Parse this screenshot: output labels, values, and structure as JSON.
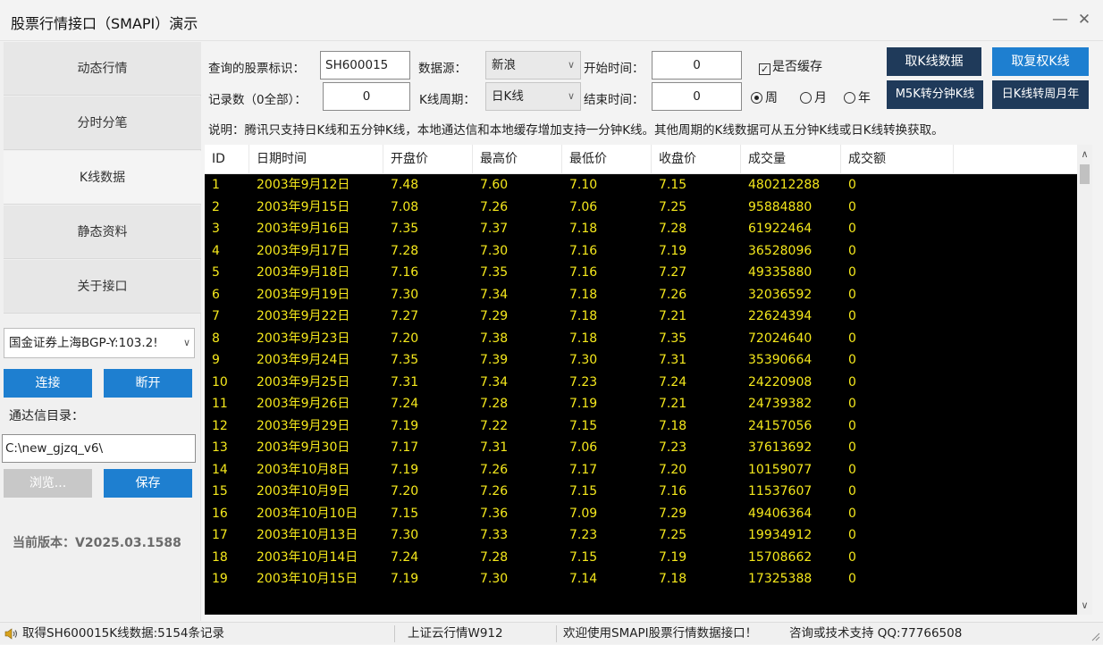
{
  "window": {
    "title": "股票行情接口（SMAPI）演示",
    "minimize_glyph": "—",
    "close_glyph": "✕"
  },
  "sidebar": {
    "nav": [
      {
        "label": "动态行情"
      },
      {
        "label": "分时分笔"
      },
      {
        "label": "K线数据"
      },
      {
        "label": "静态资料"
      },
      {
        "label": "关于接口"
      }
    ],
    "server_selected": "国金证券上海BGP-Y:103.2!",
    "connect_label": "连接",
    "disconnect_label": "断开",
    "tdx_dir_label": "通达信目录：",
    "tdx_dir_value": "C:\\new_gjzq_v6\\",
    "browse_label": "浏览...",
    "save_label": "保存",
    "version_text": "当前版本：V2025.03.1588"
  },
  "form": {
    "stock_id_label": "查询的股票标识：",
    "stock_id_value": "SH600015",
    "source_label": "数据源：",
    "source_value": "新浪",
    "start_time_label": "开始时间：",
    "start_time_value": "0",
    "cache_label": "是否缓存",
    "cache_checked": true,
    "record_count_label": "记录数（0全部）：",
    "record_count_value": "0",
    "kline_period_label": "K线周期：",
    "kline_period_value": "日K线",
    "end_time_label": "结束时间：",
    "end_time_value": "0",
    "radio_week": "周",
    "radio_month": "月",
    "radio_year": "年",
    "radio_selected": "周",
    "btn_get_kline": "取K线数据",
    "btn_get_adjusted": "取复权K线",
    "btn_m5_to_min": "M5K转分钟K线",
    "btn_day_to_wmy": "日K线转周月年",
    "notice": "说明：腾讯只支持日K线和五分钟K线，本地通达信和本地缓存增加支持一分钟K线。其他周期的K线数据可从五分钟K线或日K线转换获取。"
  },
  "table": {
    "columns": [
      "ID",
      "日期时间",
      "开盘价",
      "最高价",
      "最低价",
      "收盘价",
      "成交量",
      "成交额"
    ],
    "rows": [
      [
        "1",
        "2003年9月12日",
        "7.48",
        "7.60",
        "7.10",
        "7.15",
        "480212288",
        "0"
      ],
      [
        "2",
        "2003年9月15日",
        "7.08",
        "7.26",
        "7.06",
        "7.25",
        "95884880",
        "0"
      ],
      [
        "3",
        "2003年9月16日",
        "7.35",
        "7.37",
        "7.18",
        "7.28",
        "61922464",
        "0"
      ],
      [
        "4",
        "2003年9月17日",
        "7.28",
        "7.30",
        "7.16",
        "7.19",
        "36528096",
        "0"
      ],
      [
        "5",
        "2003年9月18日",
        "7.16",
        "7.35",
        "7.16",
        "7.27",
        "49335880",
        "0"
      ],
      [
        "6",
        "2003年9月19日",
        "7.30",
        "7.34",
        "7.18",
        "7.26",
        "32036592",
        "0"
      ],
      [
        "7",
        "2003年9月22日",
        "7.27",
        "7.29",
        "7.18",
        "7.21",
        "22624394",
        "0"
      ],
      [
        "8",
        "2003年9月23日",
        "7.20",
        "7.38",
        "7.18",
        "7.35",
        "72024640",
        "0"
      ],
      [
        "9",
        "2003年9月24日",
        "7.35",
        "7.39",
        "7.30",
        "7.31",
        "35390664",
        "0"
      ],
      [
        "10",
        "2003年9月25日",
        "7.31",
        "7.34",
        "7.23",
        "7.24",
        "24220908",
        "0"
      ],
      [
        "11",
        "2003年9月26日",
        "7.24",
        "7.28",
        "7.19",
        "7.21",
        "24739382",
        "0"
      ],
      [
        "12",
        "2003年9月29日",
        "7.19",
        "7.22",
        "7.15",
        "7.18",
        "24157056",
        "0"
      ],
      [
        "13",
        "2003年9月30日",
        "7.17",
        "7.31",
        "7.06",
        "7.23",
        "37613692",
        "0"
      ],
      [
        "14",
        "2003年10月8日",
        "7.19",
        "7.26",
        "7.17",
        "7.20",
        "10159077",
        "0"
      ],
      [
        "15",
        "2003年10月9日",
        "7.20",
        "7.26",
        "7.15",
        "7.16",
        "11537607",
        "0"
      ],
      [
        "16",
        "2003年10月10日",
        "7.15",
        "7.36",
        "7.09",
        "7.29",
        "49406364",
        "0"
      ],
      [
        "17",
        "2003年10月13日",
        "7.30",
        "7.33",
        "7.23",
        "7.25",
        "19934912",
        "0"
      ],
      [
        "18",
        "2003年10月14日",
        "7.24",
        "7.28",
        "7.15",
        "7.19",
        "15708662",
        "0"
      ],
      [
        "19",
        "2003年10月15日",
        "7.19",
        "7.30",
        "7.14",
        "7.18",
        "17325388",
        "0"
      ]
    ]
  },
  "statusbar": {
    "message": "取得SH600015K线数据:5154条记录",
    "market": "上证云行情W912",
    "welcome": "欢迎使用SMAPI股票行情数据接口！",
    "support": "咨询或技术支持 QQ:77766508"
  },
  "colors": {
    "accent_blue": "#1e7fd0",
    "navy_button": "#1f3a5a",
    "grid_background": "#000000",
    "grid_text": "#f5e81c"
  }
}
